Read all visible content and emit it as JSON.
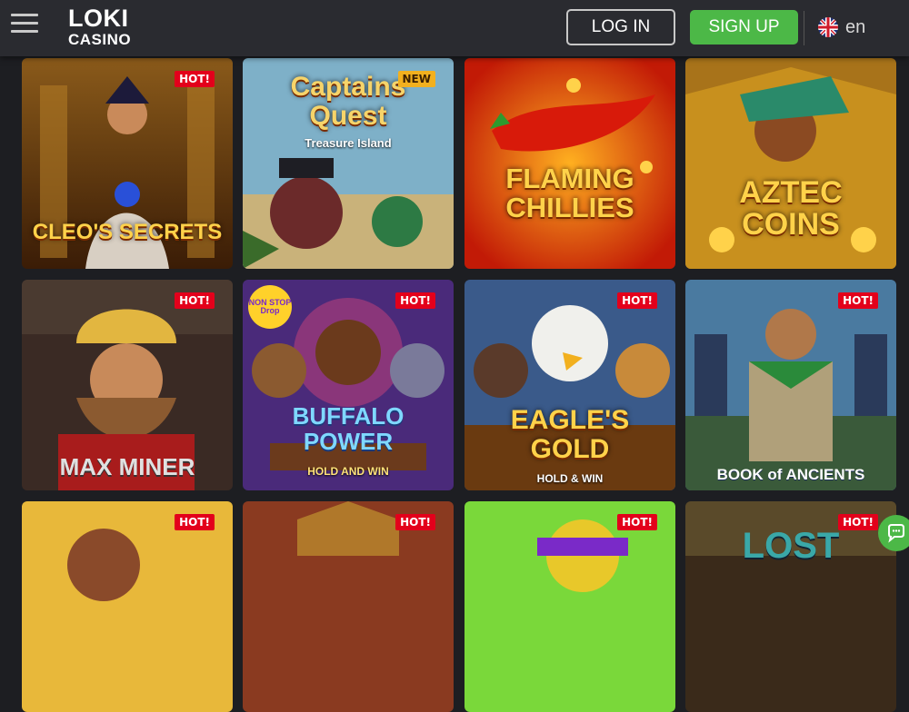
{
  "header": {
    "logo_line1": "LOKI",
    "logo_line2": "CASINO",
    "login_label": "LOG IN",
    "signup_label": "SIGN UP",
    "language": "en"
  },
  "colors": {
    "topbar": "#2a2b30",
    "background": "#1d1e22",
    "signup_green": "#4cb847",
    "hot_badge": "#e3001b",
    "new_badge": "#f2b01e"
  },
  "games": [
    {
      "title": "CLEO'S SECRETS",
      "subtitle": "",
      "badge": "HOT!"
    },
    {
      "title": "Captains Quest",
      "subtitle": "Treasure Island",
      "badge": "NEW"
    },
    {
      "title": "FLAMING CHILLIES",
      "subtitle": "",
      "badge": ""
    },
    {
      "title": "AZTEC COINS",
      "subtitle": "",
      "badge": ""
    },
    {
      "title": "MAX MINER",
      "subtitle": "",
      "badge": "HOT!"
    },
    {
      "title": "BUFFALO POWER",
      "subtitle": "HOLD AND WIN",
      "badge": "HOT!",
      "corner_label": "NON STOP Drop"
    },
    {
      "title": "EAGLE'S GOLD",
      "subtitle": "HOLD & WIN",
      "badge": "HOT!"
    },
    {
      "title": "BOOK of ANCIENTS",
      "subtitle": "",
      "badge": "HOT!"
    },
    {
      "title": "",
      "subtitle": "",
      "badge": "HOT!"
    },
    {
      "title": "",
      "subtitle": "",
      "badge": "HOT!"
    },
    {
      "title": "",
      "subtitle": "",
      "badge": "HOT!"
    },
    {
      "title": "LOST",
      "subtitle": "",
      "badge": "HOT!"
    }
  ],
  "icons": {
    "menu": "hamburger-menu-icon",
    "flag": "uk-flag-icon",
    "chat": "chat-icon"
  }
}
